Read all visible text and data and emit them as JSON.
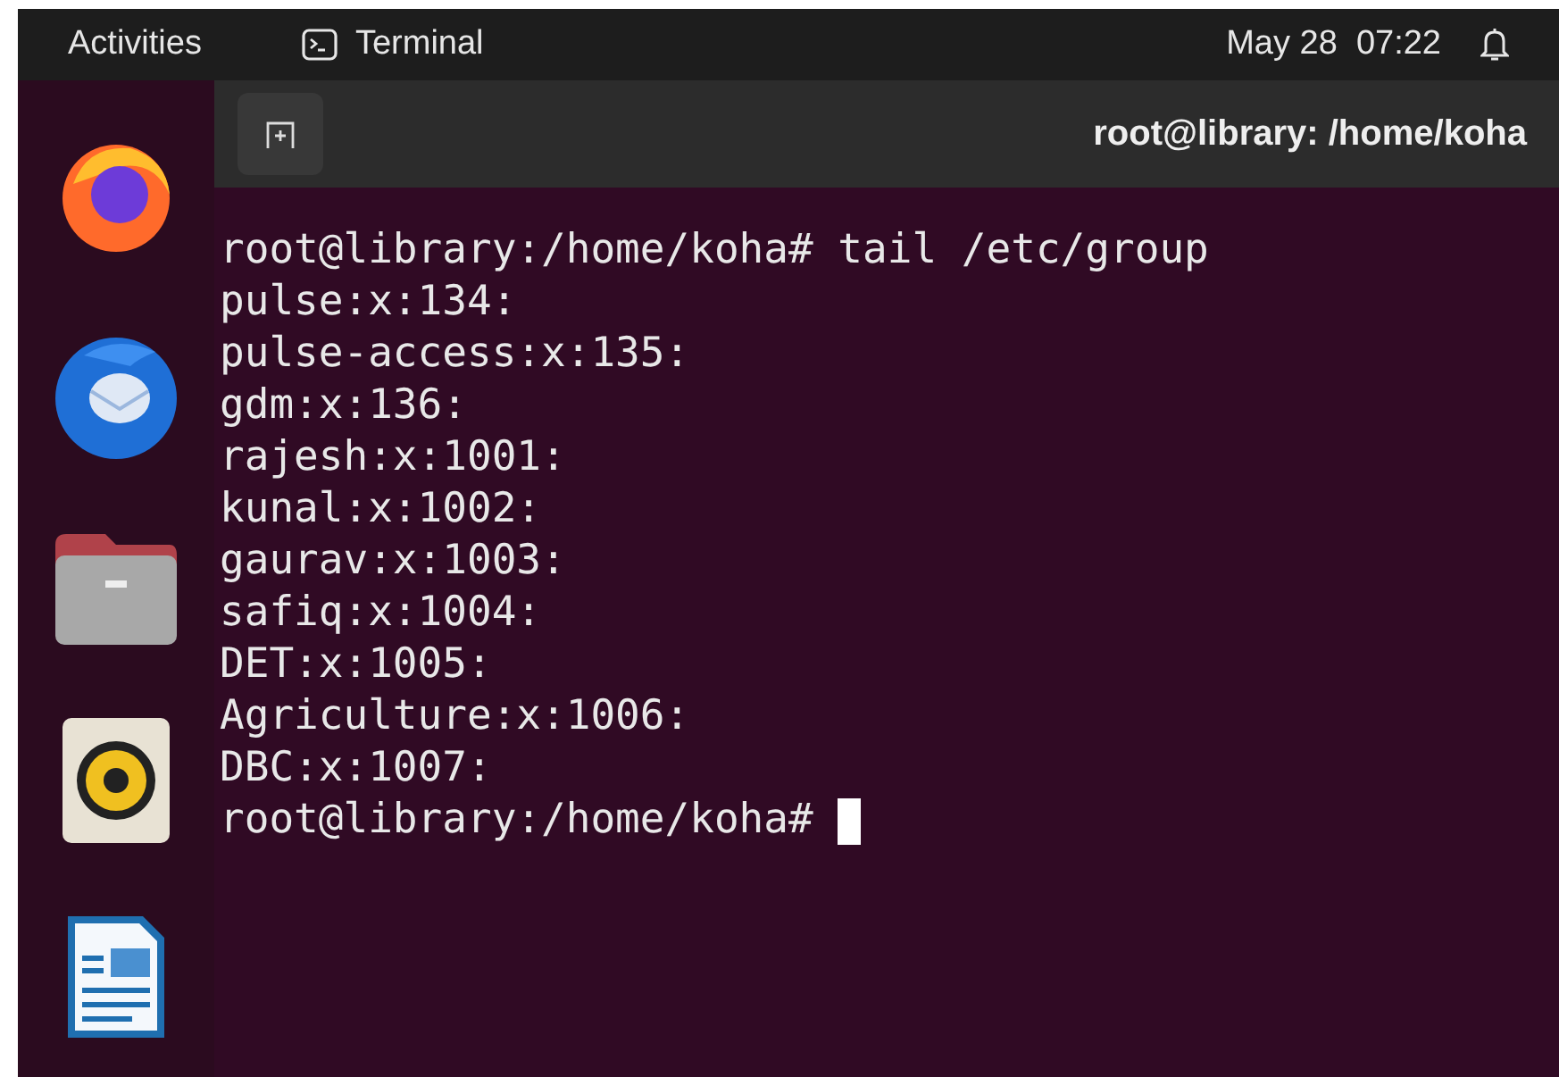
{
  "top_bar": {
    "activities": "Activities",
    "app_name": "Terminal",
    "clock": "May 28  07:22"
  },
  "terminal": {
    "title": "root@library: /home/koha",
    "lines": [
      "root@library:/home/koha# tail /etc/group",
      "pulse:x:134:",
      "pulse-access:x:135:",
      "gdm:x:136:",
      "rajesh:x:1001:",
      "kunal:x:1002:",
      "gaurav:x:1003:",
      "safiq:x:1004:",
      "DET:x:1005:",
      "Agriculture:x:1006:",
      "DBC:x:1007:"
    ],
    "prompt": "root@library:/home/koha# "
  }
}
